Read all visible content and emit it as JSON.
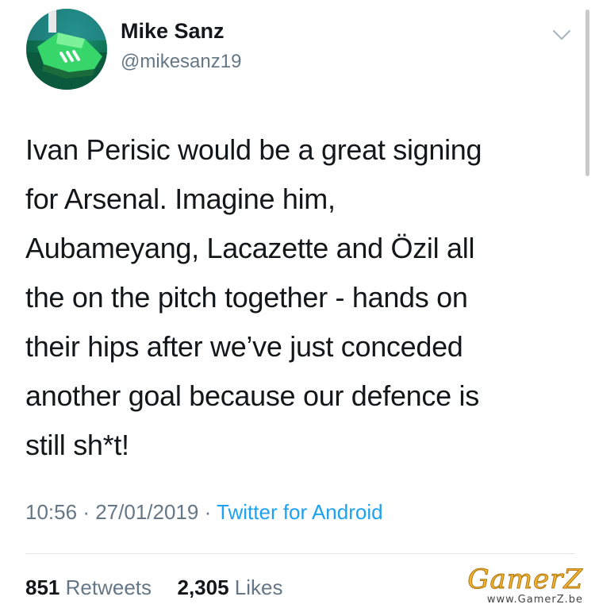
{
  "user": {
    "name": "Mike Sanz",
    "handle": "@mikesanz19",
    "avatar_icon": "football-boot-avatar"
  },
  "menu": {
    "icon": "chevron-down-icon"
  },
  "tweet": {
    "lines": [
      "Ivan Perisic would be a great signing",
      "for Arsenal. Imagine him,",
      "Aubameyang, Lacazette and Özil all",
      "the on the pitch together - hands on",
      "their hips after we’ve just conceded",
      "another goal because our defence is",
      "still sh*t!"
    ]
  },
  "meta": {
    "time": "10:56",
    "separator": "·",
    "date": "27/01/2019",
    "source": "Twitter for Android"
  },
  "stats": {
    "retweets_count": "851",
    "retweets_label": "Retweets",
    "likes_count": "2,305",
    "likes_label": "Likes"
  },
  "watermark": {
    "logo": "GamerZ",
    "url": "www.GamerZ.be"
  },
  "colors": {
    "text": "#14171a",
    "secondary": "#657786",
    "link": "#1da1f2",
    "divider": "#e1e8ed"
  }
}
